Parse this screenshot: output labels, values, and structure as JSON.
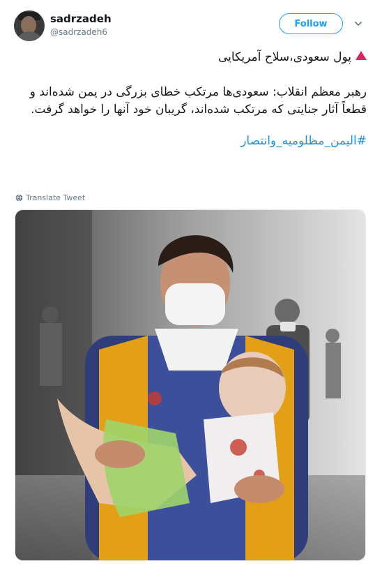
{
  "user": {
    "display_name": "sadrzadeh",
    "handle": "@sadrzadeh6"
  },
  "follow_label": "Follow",
  "tweet": {
    "line1": "پول سعودی،سلاح آمریکایی",
    "line2": "رهبر معظم انقلاب: سعودی‌ها مرتکب خطای بزرگی در یمن شده‌اند و قطعاً آثار جنایتی که مرتکب شده‌اند، گریبان خود آنها را خواهد گرفت.",
    "hashtag": "#الیمن_مظلومیه_وانتصار"
  },
  "translate_label": "Translate Tweet",
  "icons": {
    "triangle": "red-triangle-up-icon",
    "globe": "globe-icon",
    "chevron": "chevron-down-icon"
  },
  "colors": {
    "accent": "#1da1f2",
    "hashtag": "#1b95e0",
    "triangle": "#e0245e",
    "muted": "#657786"
  }
}
